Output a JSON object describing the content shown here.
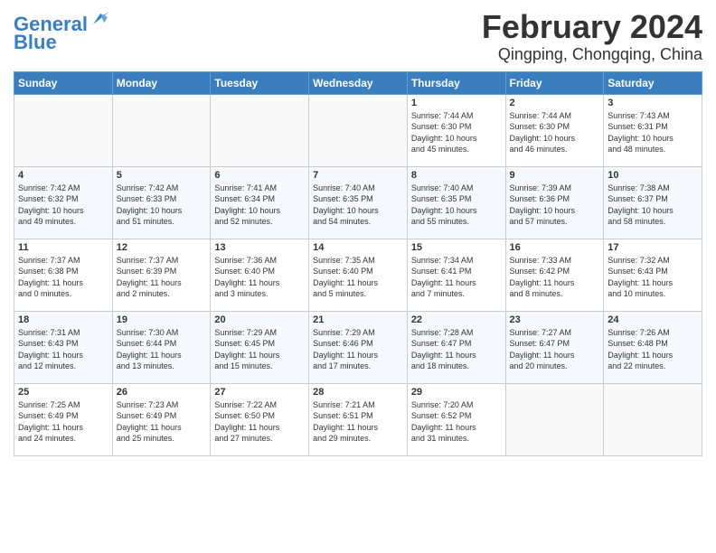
{
  "header": {
    "logo_line1": "General",
    "logo_line2": "Blue",
    "title": "February 2024",
    "subtitle": "Qingping, Chongqing, China"
  },
  "columns": [
    "Sunday",
    "Monday",
    "Tuesday",
    "Wednesday",
    "Thursday",
    "Friday",
    "Saturday"
  ],
  "weeks": [
    [
      {
        "day": "",
        "info": ""
      },
      {
        "day": "",
        "info": ""
      },
      {
        "day": "",
        "info": ""
      },
      {
        "day": "",
        "info": ""
      },
      {
        "day": "1",
        "info": "Sunrise: 7:44 AM\nSunset: 6:30 PM\nDaylight: 10 hours\nand 45 minutes."
      },
      {
        "day": "2",
        "info": "Sunrise: 7:44 AM\nSunset: 6:30 PM\nDaylight: 10 hours\nand 46 minutes."
      },
      {
        "day": "3",
        "info": "Sunrise: 7:43 AM\nSunset: 6:31 PM\nDaylight: 10 hours\nand 48 minutes."
      }
    ],
    [
      {
        "day": "4",
        "info": "Sunrise: 7:42 AM\nSunset: 6:32 PM\nDaylight: 10 hours\nand 49 minutes."
      },
      {
        "day": "5",
        "info": "Sunrise: 7:42 AM\nSunset: 6:33 PM\nDaylight: 10 hours\nand 51 minutes."
      },
      {
        "day": "6",
        "info": "Sunrise: 7:41 AM\nSunset: 6:34 PM\nDaylight: 10 hours\nand 52 minutes."
      },
      {
        "day": "7",
        "info": "Sunrise: 7:40 AM\nSunset: 6:35 PM\nDaylight: 10 hours\nand 54 minutes."
      },
      {
        "day": "8",
        "info": "Sunrise: 7:40 AM\nSunset: 6:35 PM\nDaylight: 10 hours\nand 55 minutes."
      },
      {
        "day": "9",
        "info": "Sunrise: 7:39 AM\nSunset: 6:36 PM\nDaylight: 10 hours\nand 57 minutes."
      },
      {
        "day": "10",
        "info": "Sunrise: 7:38 AM\nSunset: 6:37 PM\nDaylight: 10 hours\nand 58 minutes."
      }
    ],
    [
      {
        "day": "11",
        "info": "Sunrise: 7:37 AM\nSunset: 6:38 PM\nDaylight: 11 hours\nand 0 minutes."
      },
      {
        "day": "12",
        "info": "Sunrise: 7:37 AM\nSunset: 6:39 PM\nDaylight: 11 hours\nand 2 minutes."
      },
      {
        "day": "13",
        "info": "Sunrise: 7:36 AM\nSunset: 6:40 PM\nDaylight: 11 hours\nand 3 minutes."
      },
      {
        "day": "14",
        "info": "Sunrise: 7:35 AM\nSunset: 6:40 PM\nDaylight: 11 hours\nand 5 minutes."
      },
      {
        "day": "15",
        "info": "Sunrise: 7:34 AM\nSunset: 6:41 PM\nDaylight: 11 hours\nand 7 minutes."
      },
      {
        "day": "16",
        "info": "Sunrise: 7:33 AM\nSunset: 6:42 PM\nDaylight: 11 hours\nand 8 minutes."
      },
      {
        "day": "17",
        "info": "Sunrise: 7:32 AM\nSunset: 6:43 PM\nDaylight: 11 hours\nand 10 minutes."
      }
    ],
    [
      {
        "day": "18",
        "info": "Sunrise: 7:31 AM\nSunset: 6:43 PM\nDaylight: 11 hours\nand 12 minutes."
      },
      {
        "day": "19",
        "info": "Sunrise: 7:30 AM\nSunset: 6:44 PM\nDaylight: 11 hours\nand 13 minutes."
      },
      {
        "day": "20",
        "info": "Sunrise: 7:29 AM\nSunset: 6:45 PM\nDaylight: 11 hours\nand 15 minutes."
      },
      {
        "day": "21",
        "info": "Sunrise: 7:29 AM\nSunset: 6:46 PM\nDaylight: 11 hours\nand 17 minutes."
      },
      {
        "day": "22",
        "info": "Sunrise: 7:28 AM\nSunset: 6:47 PM\nDaylight: 11 hours\nand 18 minutes."
      },
      {
        "day": "23",
        "info": "Sunrise: 7:27 AM\nSunset: 6:47 PM\nDaylight: 11 hours\nand 20 minutes."
      },
      {
        "day": "24",
        "info": "Sunrise: 7:26 AM\nSunset: 6:48 PM\nDaylight: 11 hours\nand 22 minutes."
      }
    ],
    [
      {
        "day": "25",
        "info": "Sunrise: 7:25 AM\nSunset: 6:49 PM\nDaylight: 11 hours\nand 24 minutes."
      },
      {
        "day": "26",
        "info": "Sunrise: 7:23 AM\nSunset: 6:49 PM\nDaylight: 11 hours\nand 25 minutes."
      },
      {
        "day": "27",
        "info": "Sunrise: 7:22 AM\nSunset: 6:50 PM\nDaylight: 11 hours\nand 27 minutes."
      },
      {
        "day": "28",
        "info": "Sunrise: 7:21 AM\nSunset: 6:51 PM\nDaylight: 11 hours\nand 29 minutes."
      },
      {
        "day": "29",
        "info": "Sunrise: 7:20 AM\nSunset: 6:52 PM\nDaylight: 11 hours\nand 31 minutes."
      },
      {
        "day": "",
        "info": ""
      },
      {
        "day": "",
        "info": ""
      }
    ]
  ]
}
